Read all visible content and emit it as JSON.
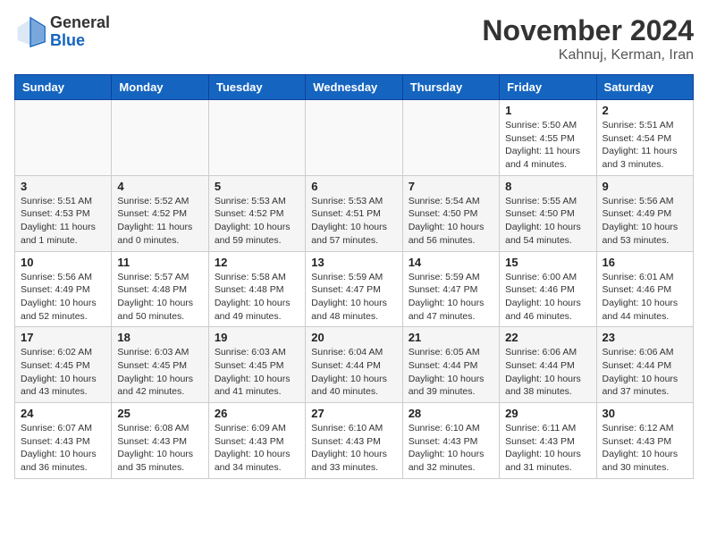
{
  "header": {
    "logo_general": "General",
    "logo_blue": "Blue",
    "month_title": "November 2024",
    "location": "Kahnuj, Kerman, Iran"
  },
  "weekdays": [
    "Sunday",
    "Monday",
    "Tuesday",
    "Wednesday",
    "Thursday",
    "Friday",
    "Saturday"
  ],
  "weeks": [
    [
      {
        "day": "",
        "info": ""
      },
      {
        "day": "",
        "info": ""
      },
      {
        "day": "",
        "info": ""
      },
      {
        "day": "",
        "info": ""
      },
      {
        "day": "",
        "info": ""
      },
      {
        "day": "1",
        "info": "Sunrise: 5:50 AM\nSunset: 4:55 PM\nDaylight: 11 hours\nand 4 minutes."
      },
      {
        "day": "2",
        "info": "Sunrise: 5:51 AM\nSunset: 4:54 PM\nDaylight: 11 hours\nand 3 minutes."
      }
    ],
    [
      {
        "day": "3",
        "info": "Sunrise: 5:51 AM\nSunset: 4:53 PM\nDaylight: 11 hours\nand 1 minute."
      },
      {
        "day": "4",
        "info": "Sunrise: 5:52 AM\nSunset: 4:52 PM\nDaylight: 11 hours\nand 0 minutes."
      },
      {
        "day": "5",
        "info": "Sunrise: 5:53 AM\nSunset: 4:52 PM\nDaylight: 10 hours\nand 59 minutes."
      },
      {
        "day": "6",
        "info": "Sunrise: 5:53 AM\nSunset: 4:51 PM\nDaylight: 10 hours\nand 57 minutes."
      },
      {
        "day": "7",
        "info": "Sunrise: 5:54 AM\nSunset: 4:50 PM\nDaylight: 10 hours\nand 56 minutes."
      },
      {
        "day": "8",
        "info": "Sunrise: 5:55 AM\nSunset: 4:50 PM\nDaylight: 10 hours\nand 54 minutes."
      },
      {
        "day": "9",
        "info": "Sunrise: 5:56 AM\nSunset: 4:49 PM\nDaylight: 10 hours\nand 53 minutes."
      }
    ],
    [
      {
        "day": "10",
        "info": "Sunrise: 5:56 AM\nSunset: 4:49 PM\nDaylight: 10 hours\nand 52 minutes."
      },
      {
        "day": "11",
        "info": "Sunrise: 5:57 AM\nSunset: 4:48 PM\nDaylight: 10 hours\nand 50 minutes."
      },
      {
        "day": "12",
        "info": "Sunrise: 5:58 AM\nSunset: 4:48 PM\nDaylight: 10 hours\nand 49 minutes."
      },
      {
        "day": "13",
        "info": "Sunrise: 5:59 AM\nSunset: 4:47 PM\nDaylight: 10 hours\nand 48 minutes."
      },
      {
        "day": "14",
        "info": "Sunrise: 5:59 AM\nSunset: 4:47 PM\nDaylight: 10 hours\nand 47 minutes."
      },
      {
        "day": "15",
        "info": "Sunrise: 6:00 AM\nSunset: 4:46 PM\nDaylight: 10 hours\nand 46 minutes."
      },
      {
        "day": "16",
        "info": "Sunrise: 6:01 AM\nSunset: 4:46 PM\nDaylight: 10 hours\nand 44 minutes."
      }
    ],
    [
      {
        "day": "17",
        "info": "Sunrise: 6:02 AM\nSunset: 4:45 PM\nDaylight: 10 hours\nand 43 minutes."
      },
      {
        "day": "18",
        "info": "Sunrise: 6:03 AM\nSunset: 4:45 PM\nDaylight: 10 hours\nand 42 minutes."
      },
      {
        "day": "19",
        "info": "Sunrise: 6:03 AM\nSunset: 4:45 PM\nDaylight: 10 hours\nand 41 minutes."
      },
      {
        "day": "20",
        "info": "Sunrise: 6:04 AM\nSunset: 4:44 PM\nDaylight: 10 hours\nand 40 minutes."
      },
      {
        "day": "21",
        "info": "Sunrise: 6:05 AM\nSunset: 4:44 PM\nDaylight: 10 hours\nand 39 minutes."
      },
      {
        "day": "22",
        "info": "Sunrise: 6:06 AM\nSunset: 4:44 PM\nDaylight: 10 hours\nand 38 minutes."
      },
      {
        "day": "23",
        "info": "Sunrise: 6:06 AM\nSunset: 4:44 PM\nDaylight: 10 hours\nand 37 minutes."
      }
    ],
    [
      {
        "day": "24",
        "info": "Sunrise: 6:07 AM\nSunset: 4:43 PM\nDaylight: 10 hours\nand 36 minutes."
      },
      {
        "day": "25",
        "info": "Sunrise: 6:08 AM\nSunset: 4:43 PM\nDaylight: 10 hours\nand 35 minutes."
      },
      {
        "day": "26",
        "info": "Sunrise: 6:09 AM\nSunset: 4:43 PM\nDaylight: 10 hours\nand 34 minutes."
      },
      {
        "day": "27",
        "info": "Sunrise: 6:10 AM\nSunset: 4:43 PM\nDaylight: 10 hours\nand 33 minutes."
      },
      {
        "day": "28",
        "info": "Sunrise: 6:10 AM\nSunset: 4:43 PM\nDaylight: 10 hours\nand 32 minutes."
      },
      {
        "day": "29",
        "info": "Sunrise: 6:11 AM\nSunset: 4:43 PM\nDaylight: 10 hours\nand 31 minutes."
      },
      {
        "day": "30",
        "info": "Sunrise: 6:12 AM\nSunset: 4:43 PM\nDaylight: 10 hours\nand 30 minutes."
      }
    ]
  ]
}
